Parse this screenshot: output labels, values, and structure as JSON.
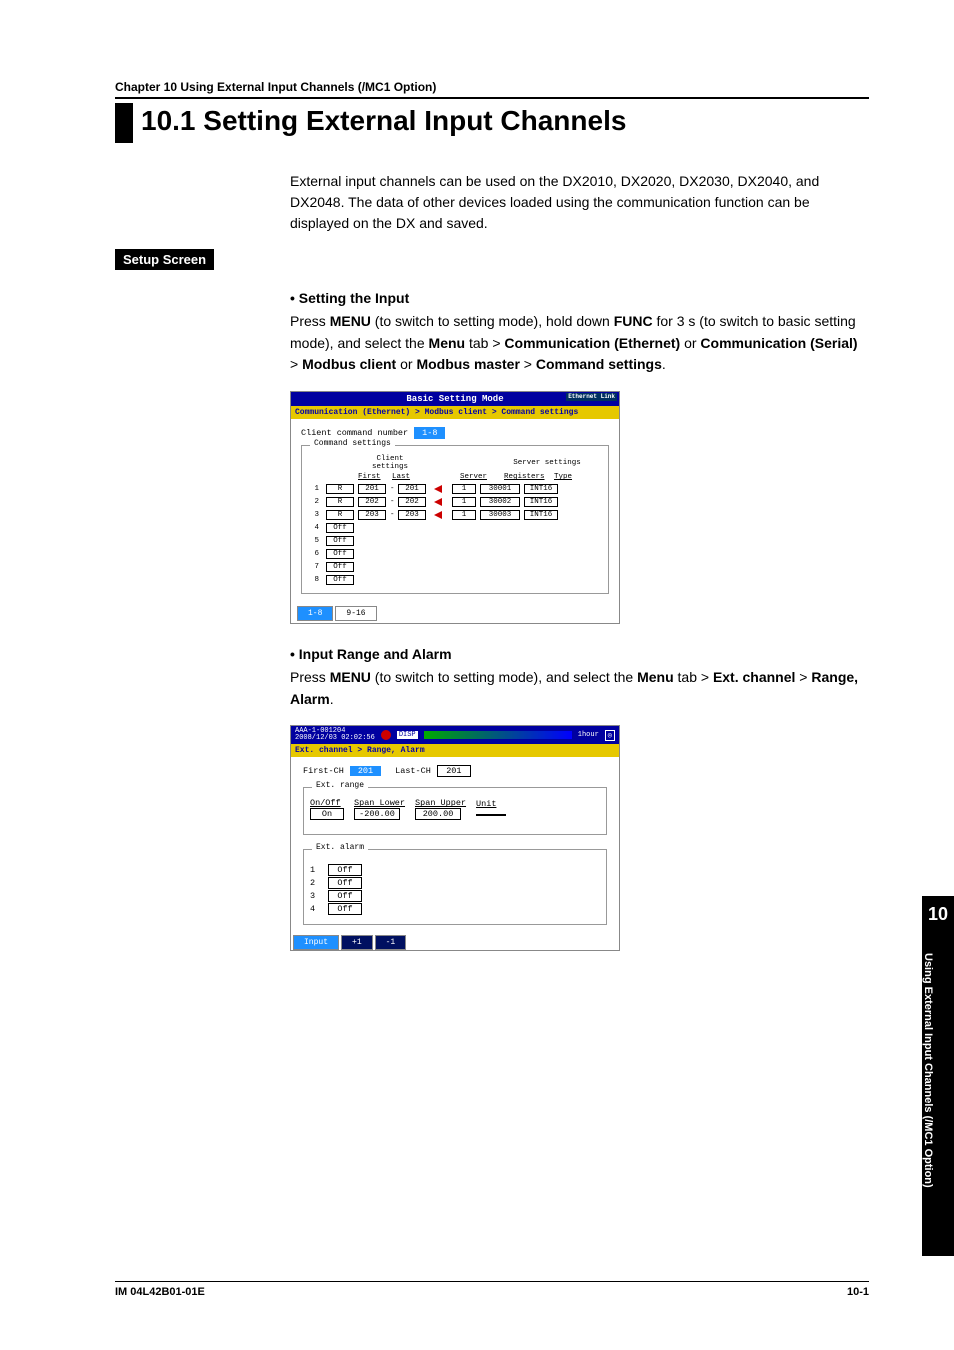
{
  "chapter_header": "Chapter 10   Using External Input Channels (/MC1 Option)",
  "heading": "10.1  Setting External Input Channels",
  "intro": "External input channels can be used on the DX2010, DX2020, DX2030, DX2040, and DX2048. The data of other devices loaded using the communication function can be displayed on the DX and saved.",
  "setup_screen": "Setup Screen",
  "section1": {
    "title": "Setting the Input",
    "text_pre": "Press ",
    "menu": "MENU",
    "text_mid1": " (to switch to setting mode), hold down ",
    "func": "FUNC",
    "text_mid2": " for 3 s (to switch to basic setting mode), and select the ",
    "menu_tab": "Menu",
    "gt": " tab > ",
    "comm_eth": "Communication (Ethernet)",
    "or": " or ",
    "comm_ser": "Communication (Serial)",
    "gt2": " > ",
    "modbus_client": "Modbus client",
    "or2": " or ",
    "modbus_master": "Modbus master",
    "gt3": " > ",
    "cmd_settings": "Command settings",
    "dot": "."
  },
  "shot1": {
    "title": "Basic Setting Mode",
    "eth": "Ethernet Link",
    "breadcrumb": "Communication (Ethernet) > Modbus client > Command settings",
    "client_cmd_num": "Client command number",
    "range": "1-8",
    "fieldset": "Command settings",
    "client_settings": "Client settings",
    "server_settings": "Server settings",
    "cols": {
      "first": "First",
      "last": "Last",
      "server": "Server",
      "registers": "Registers",
      "type": "Type"
    },
    "rows": [
      {
        "n": "1",
        "rw": "R",
        "first": "201",
        "last": "201",
        "server": "1",
        "reg": "30001",
        "type": "INT16"
      },
      {
        "n": "2",
        "rw": "R",
        "first": "202",
        "last": "202",
        "server": "1",
        "reg": "30002",
        "type": "INT16"
      },
      {
        "n": "3",
        "rw": "R",
        "first": "203",
        "last": "203",
        "server": "1",
        "reg": "30003",
        "type": "INT16"
      },
      {
        "n": "4",
        "rw": "Off"
      },
      {
        "n": "5",
        "rw": "Off"
      },
      {
        "n": "6",
        "rw": "Off"
      },
      {
        "n": "7",
        "rw": "Off"
      },
      {
        "n": "8",
        "rw": "Off"
      }
    ],
    "tabs": [
      "1-8",
      "9-16"
    ]
  },
  "section2": {
    "title": "Input Range and Alarm",
    "text_pre": "Press ",
    "menu": "MENU",
    "text_mid1": " (to switch to setting mode), and select the ",
    "menu_tab": "Menu",
    "gt": " tab > ",
    "ext_ch": "Ext. channel",
    "gt2": " > ",
    "range_alarm": "Range, Alarm",
    "dot": "."
  },
  "shot2": {
    "model": "AAA-1-001204",
    "datetime": "2008/12/03 02:02:56",
    "disp": "DISP",
    "hour": "1hour",
    "breadcrumb": "Ext. channel > Range, Alarm",
    "first_ch_lbl": "First-CH",
    "first_ch": "201",
    "last_ch_lbl": "Last-CH",
    "last_ch": "201",
    "ext_range": "Ext. range",
    "onoff_lbl": "On/Off",
    "onoff": "On",
    "span_lower_lbl": "Span Lower",
    "span_lower": "-200.00",
    "span_upper_lbl": "Span Upper",
    "span_upper": "200.00",
    "unit_lbl": "Unit",
    "unit": " ",
    "ext_alarm": "Ext. alarm",
    "alarms": [
      {
        "n": "1",
        "v": "Off"
      },
      {
        "n": "2",
        "v": "Off"
      },
      {
        "n": "3",
        "v": "Off"
      },
      {
        "n": "4",
        "v": "Off"
      }
    ],
    "tabs": [
      "Input",
      "+1",
      "-1"
    ]
  },
  "side": {
    "num": "10",
    "text": "Using External Input Channels (/MC1 Option)"
  },
  "footer": {
    "left": "IM 04L42B01-01E",
    "right": "10-1"
  }
}
